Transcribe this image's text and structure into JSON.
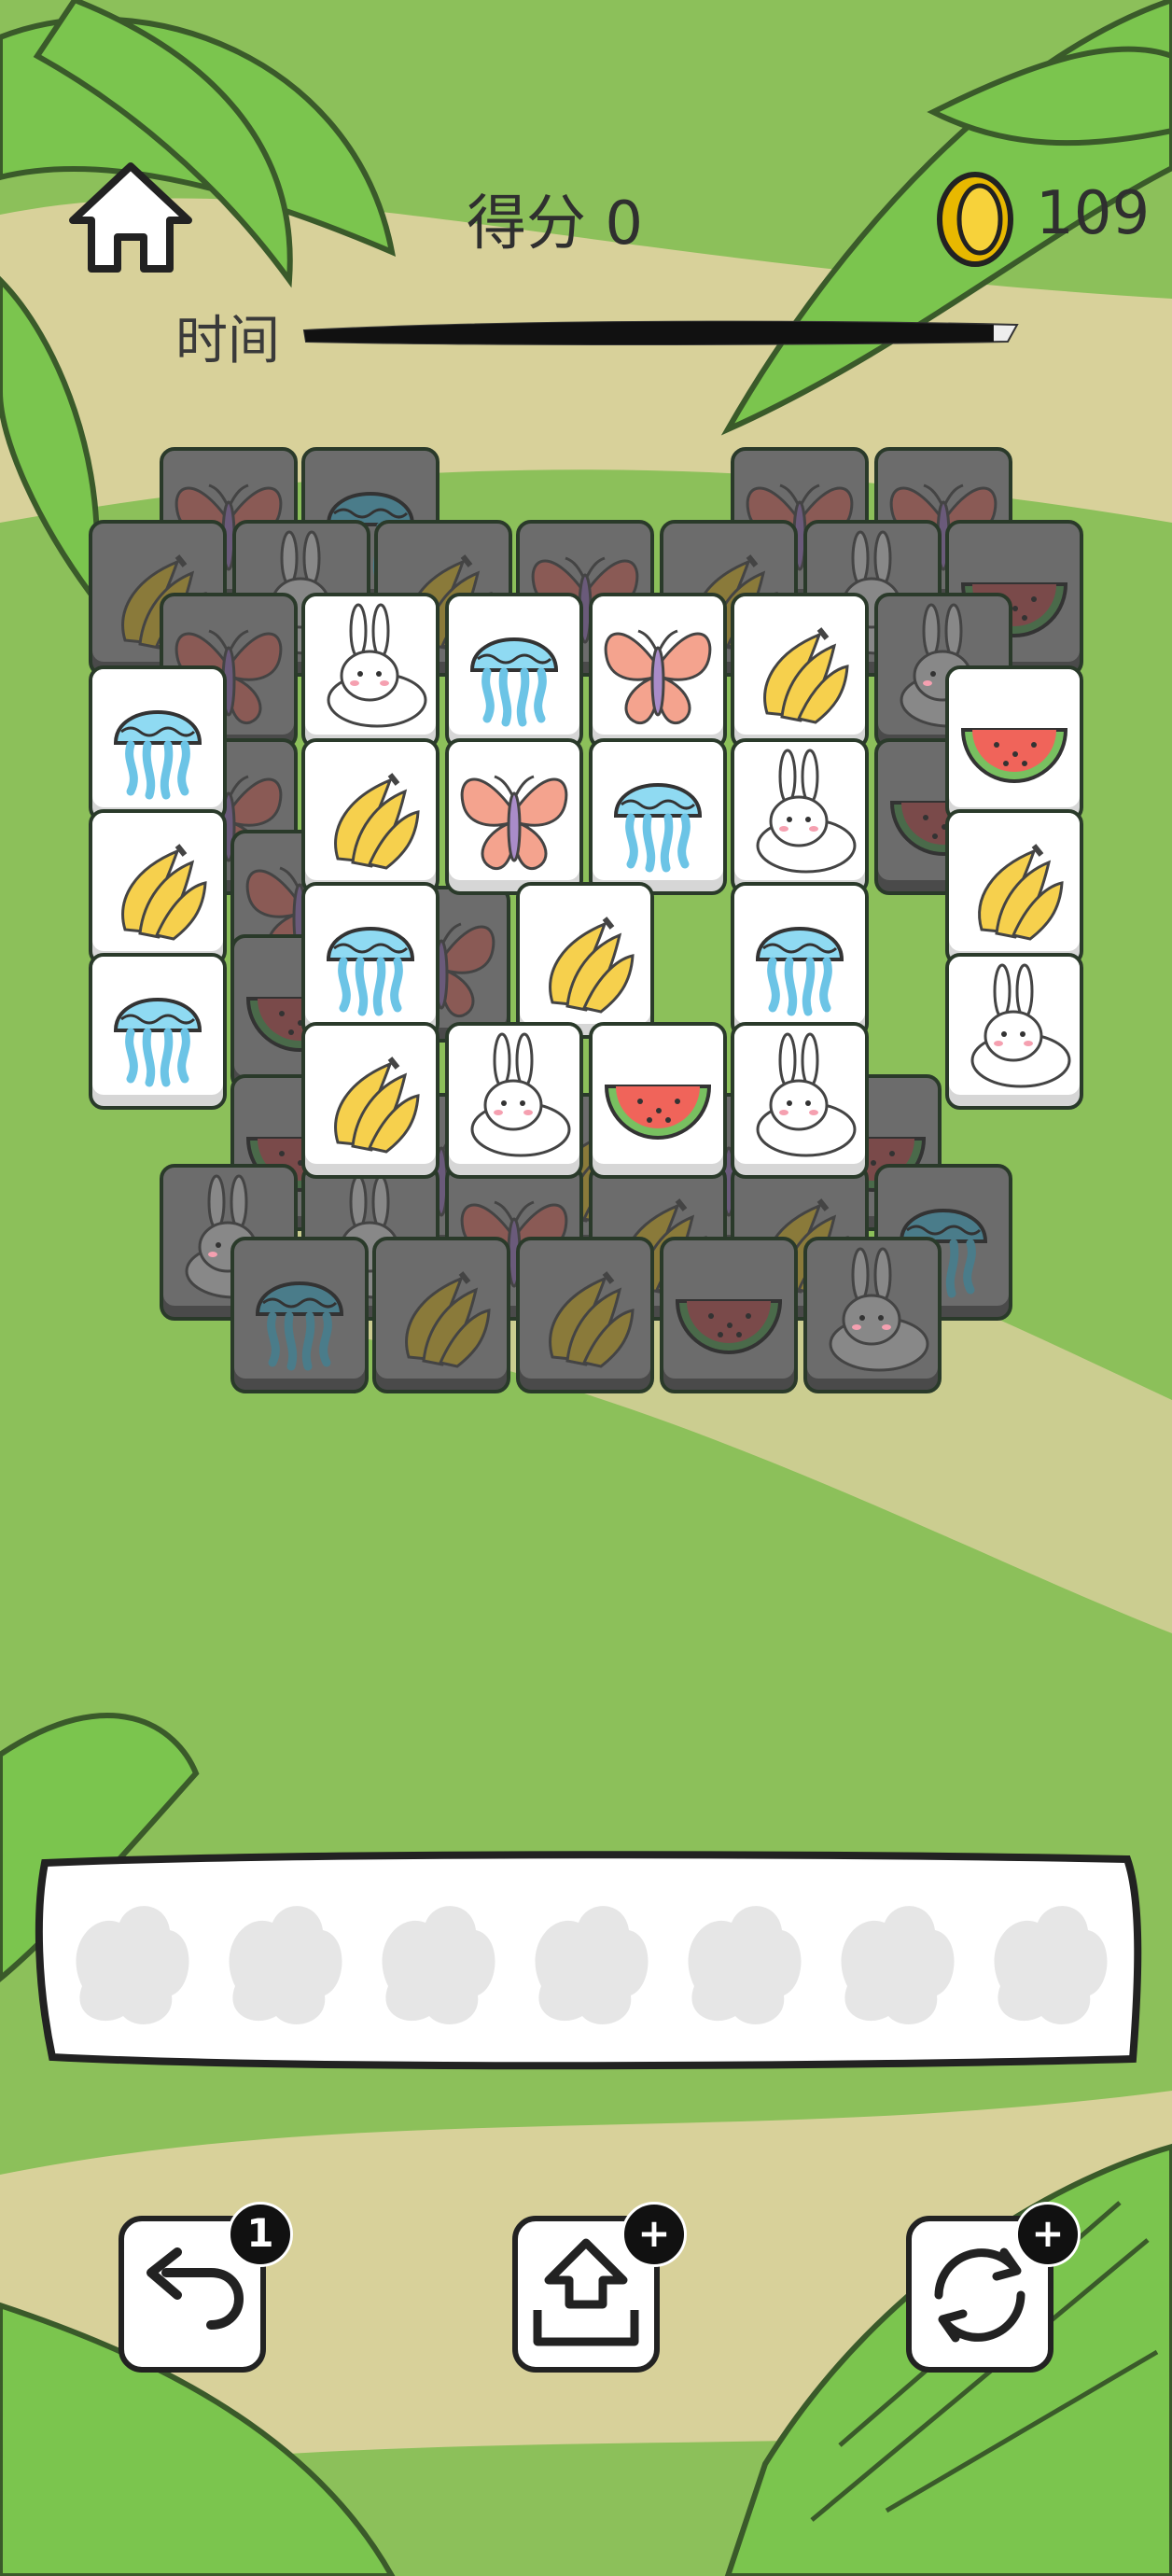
{
  "header": {
    "score_label": "得分",
    "score_value": "0",
    "coins": "109",
    "time_label": "时间",
    "time_remaining_fraction": 0.98
  },
  "tiles": {
    "types": [
      "butterfly",
      "jellyfish",
      "rabbit",
      "banana",
      "watermelon"
    ]
  },
  "board_active": [
    {
      "id": "r1c1",
      "kind": "rabbit"
    },
    {
      "id": "r1c2",
      "kind": "jellyfish"
    },
    {
      "id": "r1c3",
      "kind": "butterfly"
    },
    {
      "id": "r1c4",
      "kind": "banana"
    },
    {
      "id": "l1",
      "kind": "jellyfish"
    },
    {
      "id": "rt1",
      "kind": "watermelon"
    },
    {
      "id": "r2c1",
      "kind": "banana"
    },
    {
      "id": "r2c2",
      "kind": "butterfly"
    },
    {
      "id": "r2c3",
      "kind": "jellyfish"
    },
    {
      "id": "r2c4",
      "kind": "rabbit"
    },
    {
      "id": "l2",
      "kind": "banana"
    },
    {
      "id": "rt2",
      "kind": "banana"
    },
    {
      "id": "r3c1",
      "kind": "jellyfish"
    },
    {
      "id": "r3c2",
      "kind": "banana"
    },
    {
      "id": "r3c3",
      "kind": "jellyfish"
    },
    {
      "id": "l3",
      "kind": "jellyfish"
    },
    {
      "id": "rt3",
      "kind": "rabbit"
    },
    {
      "id": "r4c1",
      "kind": "banana"
    },
    {
      "id": "r4c2",
      "kind": "rabbit"
    },
    {
      "id": "r4c3",
      "kind": "watermelon"
    },
    {
      "id": "r4c4",
      "kind": "rabbit"
    }
  ],
  "board_blocked": [
    "butterfly",
    "jellyfish",
    "butterfly",
    "butterfly",
    "banana",
    "rabbit",
    "banana",
    "butterfly",
    "banana",
    "rabbit",
    "watermelon",
    "butterfly",
    "butterfly",
    "butterfly",
    "butterfly",
    "rabbit",
    "watermelon",
    "watermelon",
    "watermelon",
    "butterfly",
    "banana",
    "butterfly",
    "watermelon",
    "rabbit",
    "rabbit",
    "butterfly",
    "banana",
    "banana",
    "jellyfish",
    "jellyfish",
    "banana",
    "banana",
    "watermelon",
    "rabbit"
  ],
  "tray": {
    "slots": 7
  },
  "tools": {
    "undo_badge": "1",
    "shift_badge": "+",
    "shuffle_badge": "+"
  },
  "colors": {
    "grass": "#8cc05a",
    "sand": "#e5d3a6",
    "leaf": "#7bc54e",
    "tile_face": "#ffffff",
    "tile_blocked": "#6c6c6c"
  }
}
